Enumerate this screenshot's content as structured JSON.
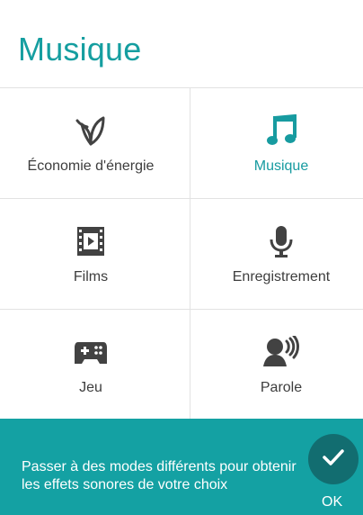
{
  "dialog": {
    "title": "Musique"
  },
  "modes": [
    {
      "label": "Économie d'énergie",
      "icon": "leaf-icon",
      "active": false
    },
    {
      "label": "Musique",
      "icon": "music-note-icon",
      "active": true
    },
    {
      "label": "Films",
      "icon": "film-icon",
      "active": false
    },
    {
      "label": "Enregistrement",
      "icon": "microphone-icon",
      "active": false
    },
    {
      "label": "Jeu",
      "icon": "gamepad-icon",
      "active": false
    },
    {
      "label": "Parole",
      "icon": "speaker-person-icon",
      "active": false
    }
  ],
  "footer": {
    "message": "Passer à des modes différents pour obtenir les effets sonores de votre choix",
    "ok_label": "OK",
    "ok_icon": "checkmark-icon"
  },
  "colors": {
    "accent": "#159ea0",
    "footer_bg": "#14a1a3",
    "ok_circle": "#126d70",
    "icon_default": "#424242"
  }
}
